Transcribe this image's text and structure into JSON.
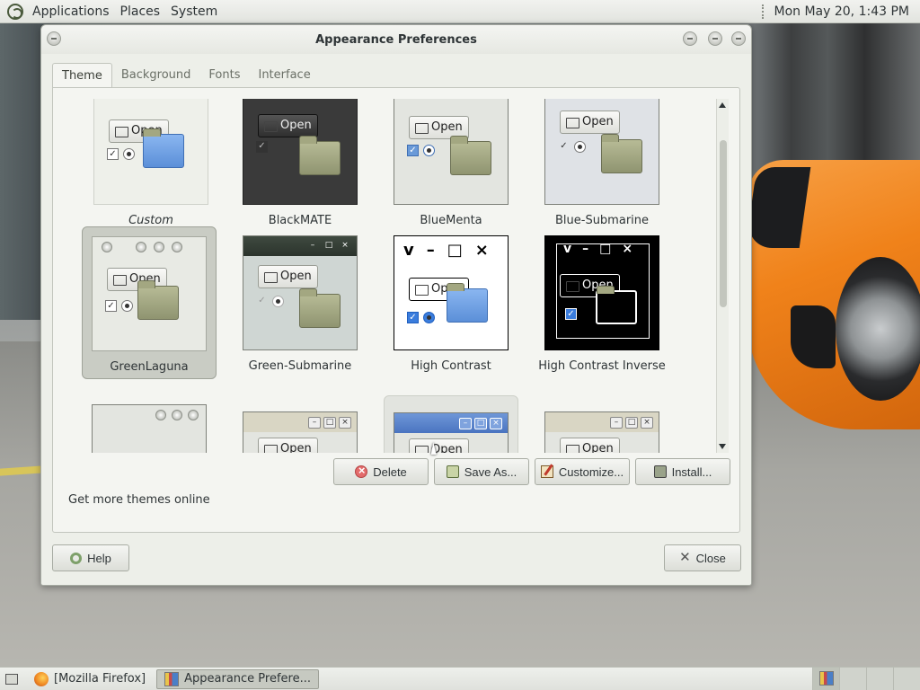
{
  "top_panel": {
    "menus": [
      "Applications",
      "Places",
      "System"
    ],
    "clock": "Mon May 20,  1:43 PM"
  },
  "dialog": {
    "title": "Appearance Preferences",
    "tabs": [
      "Theme",
      "Background",
      "Fonts",
      "Interface"
    ],
    "active_tab": "Theme",
    "themes": [
      {
        "name": "Custom"
      },
      {
        "name": "BlackMATE"
      },
      {
        "name": "BlueMenta"
      },
      {
        "name": "Blue-Submarine"
      },
      {
        "name": "GreenLaguna",
        "selected": true
      },
      {
        "name": "Green-Submarine"
      },
      {
        "name": "High Contrast"
      },
      {
        "name": "High Contrast Inverse"
      }
    ],
    "thumbnail_label": "Open",
    "buttons": {
      "delete": "Delete",
      "save_as": "Save As...",
      "customize": "Customize...",
      "install": "Install...",
      "help": "Help",
      "close": "Close"
    },
    "more_themes_link": "Get more themes online"
  },
  "taskbar": {
    "tasks": [
      {
        "label": "[Mozilla Firefox]",
        "active": false
      },
      {
        "label": "Appearance Prefere...",
        "active": true
      }
    ]
  },
  "colors": {
    "dialog_bg": "#edefe9",
    "selected_theme_bg": "#c9ccc4",
    "folder_green": "#9fa37c",
    "blue_folder": "#6fa3e6"
  }
}
